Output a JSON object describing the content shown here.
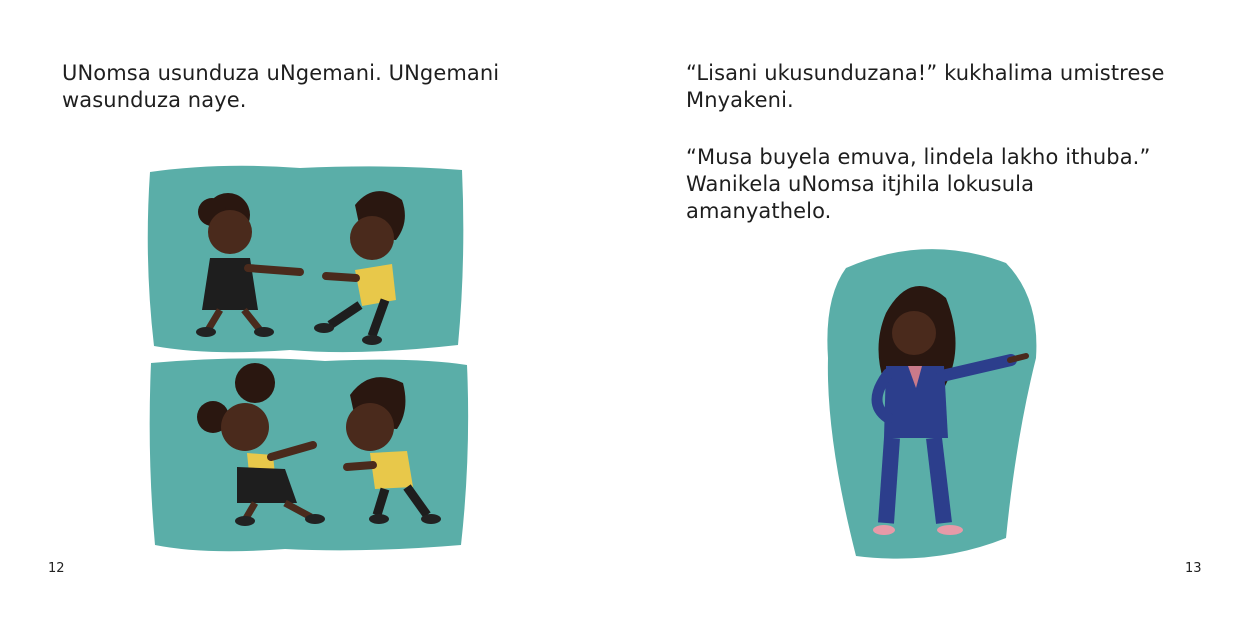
{
  "left_page": {
    "text_lines": [
      "UNomsa usunduza uNgemani. UNgemani",
      "wasunduza naye."
    ],
    "page_number": "12"
  },
  "right_page": {
    "paragraph1": [
      "“Lisani ukusunduzana!” kukhalima umistrese",
      "Mnyakeni."
    ],
    "paragraph2": [
      "“Musa buyela emuva, lindela lakho ithuba.”",
      "Wanikela uNomsa itjhila lokusula",
      "amanyathelo."
    ],
    "page_number": "13"
  },
  "colors": {
    "teal": "#5aaea8",
    "skin": "#4a2a1c",
    "hair": "#2a1710",
    "yellow_shirt": "#e8c84a",
    "dress": "#1e1e1e",
    "suit": "#2c3e8c"
  },
  "illustrations": {
    "top_panel": "two-children-pushing-each-other",
    "bottom_panel": "two-children-pushing-each-other",
    "right": "teacher-pointing"
  }
}
